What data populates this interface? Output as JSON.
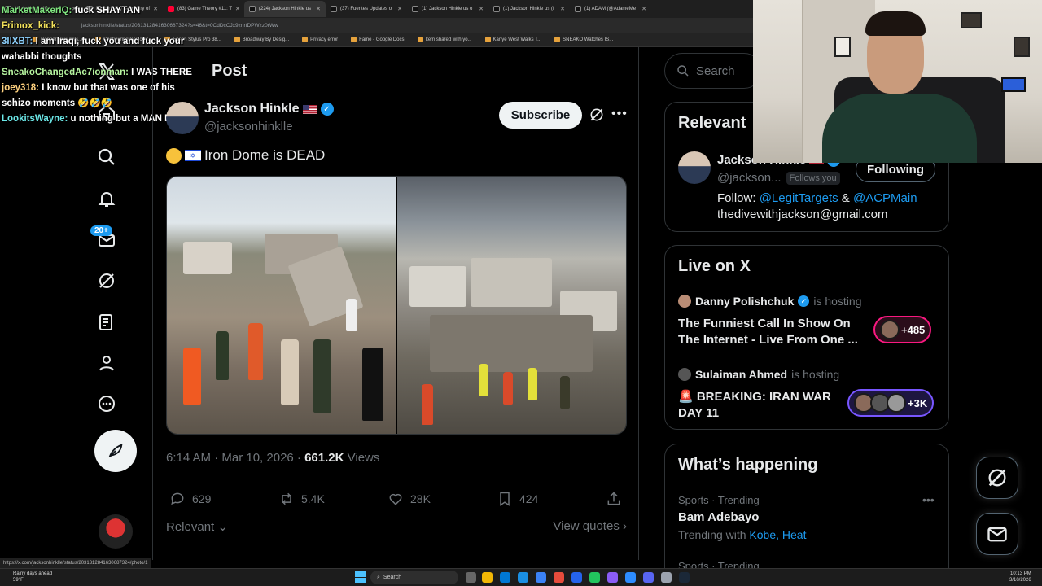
{
  "browser": {
    "tabs": [
      {
        "title": "MarketMakerIQ",
        "icon": "x",
        "active": false
      },
      {
        "title": "Remarks by Secretary of",
        "icon": "doc",
        "active": false
      },
      {
        "title": "(83) Game Theory #11: T",
        "icon": "yt",
        "active": false
      },
      {
        "title": "(224) Jackson Hinkle us",
        "icon": "x",
        "active": true
      },
      {
        "title": "(37) Fuentes Updates o",
        "icon": "x",
        "active": false
      },
      {
        "title": "(1) Jackson Hinkle us o",
        "icon": "x",
        "active": false
      },
      {
        "title": "(1) Jackson Hinkle us (f",
        "icon": "x",
        "active": false
      },
      {
        "title": "(1) ADAM (@AdameMe",
        "icon": "x",
        "active": false
      }
    ],
    "url": "jacksonhinklle/status/2031312841630687324?s=46&t=0CdDcCJx9znrtDPWzz0rWw",
    "bookmarks": [
      "Copper Raw plus...",
      "Configuring Sonic W...",
      "Epson Stylus Pro 38...",
      "Broadway By Desig...",
      "Privacy error",
      "Fame - Google Docs",
      "Item shared with yo...",
      "Kanye West Walks T...",
      "SNEAKO Watches IS..."
    ],
    "status_url": "https://x.com/jacksonhinklle/status/2031312841630687324/photo/1"
  },
  "chat": [
    {
      "user": "MarketMakerIQ:",
      "msg": " fuck SHAYTAN",
      "cls": "u1"
    },
    {
      "user": "Frimox_kick:",
      "msg": "",
      "cls": "u2"
    },
    {
      "user": "3llXBT:",
      "msg": " I am Iraqi, fuck you and fuck your wahabbi thoughts",
      "cls": "u3"
    },
    {
      "user": "SneakoChangedAc7ionman:",
      "msg": " I WAS THERE",
      "cls": "u4"
    },
    {
      "user": "joey318:",
      "msg": " I know but that was one of his schizo moments 🤣🤣🤣",
      "cls": "u5"
    },
    {
      "user": "LookitsWayne:",
      "msg": " u nothing but a MAN LOVER",
      "cls": "u6"
    }
  ],
  "nav": {
    "notifications_badge": "20+"
  },
  "post": {
    "header": "Post",
    "author_name": "Jackson Hinkle",
    "author_handle": "@jacksonhinklle",
    "subscribe_label": "Subscribe",
    "text": "Iron Dome is DEAD",
    "time": "6:14 AM · Mar 10, 2026 · ",
    "views_count": "661.2K",
    "views_label": " Views",
    "replies": "629",
    "reposts": "5.4K",
    "likes": "28K",
    "bookmarks": "424",
    "sort_label": "Relevant",
    "view_quotes": "View quotes"
  },
  "sidebar": {
    "search_placeholder": "Search",
    "relevant_title": "Relevant",
    "rel_name": "Jackson Hinkle",
    "rel_handle": "@jackson...",
    "follows_you": "Follows you",
    "following_label": "Following",
    "bio_prefix": "Follow: ",
    "bio_link1": "@LegitTargets",
    "bio_amp": " & ",
    "bio_link2": "@ACPMain",
    "bio_email": "thedivewithjackson@gmail.com",
    "live_title": "Live on X",
    "space1_host": "Danny Polishchuk",
    "space1_status": "is hosting",
    "space1_title": "The Funniest Call In Show On The Internet - Live From One ...",
    "space1_count": "+485",
    "space2_host": "Sulaiman Ahmed",
    "space2_status": "is hosting",
    "space2_title": "🚨 BREAKING: IRAN WAR DAY 11",
    "space2_count": "+3K",
    "happening_title": "What’s happening",
    "trend1_meta": "Sports · Trending",
    "trend1_name": "Bam Adebayo",
    "trend1_with": "Trending with ",
    "trend1_links": "Kobe, Heat",
    "trend2_meta": "Sports · Trending"
  },
  "taskbar": {
    "weather_line1": "Rainy days ahead",
    "weather_line2": "59°F",
    "search_label": "Search",
    "time": "10:13 PM",
    "date": "3/10/2026"
  },
  "colors": {
    "accent": "#1d9bf0",
    "bg": "#000000",
    "border": "#2f3336",
    "muted": "#71767b"
  }
}
